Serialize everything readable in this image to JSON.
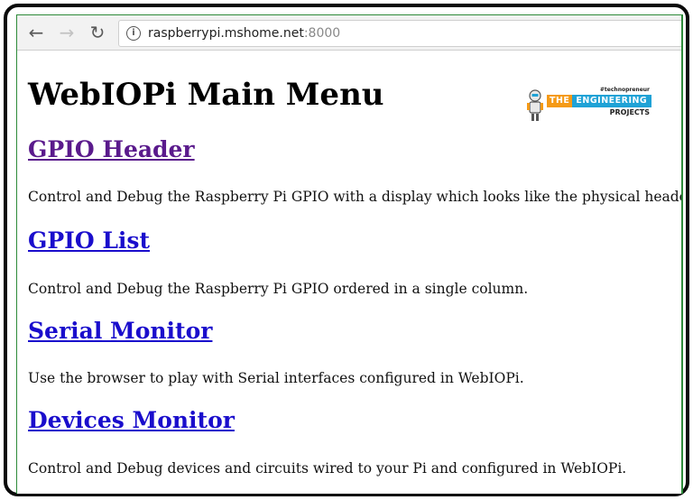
{
  "browser": {
    "nav": {
      "back_icon": "arrow-left",
      "forward_icon": "arrow-right",
      "reload_icon": "reload"
    },
    "address": {
      "host": "raspberrypi.mshome.net",
      "port": ":8000",
      "info_icon": "info-circle"
    }
  },
  "page": {
    "title": "WebIOPi Main Menu",
    "sections": [
      {
        "link": "GPIO Header",
        "description": "Control and Debug the Raspberry Pi GPIO with a display which looks like the physical header."
      },
      {
        "link": "GPIO List",
        "description": "Control and Debug the Raspberry Pi GPIO ordered in a single column."
      },
      {
        "link": "Serial Monitor",
        "description": "Use the browser to play with Serial interfaces configured in WebIOPi."
      },
      {
        "link": "Devices Monitor",
        "description": "Control and Debug devices and circuits wired to your Pi and configured in WebIOPi."
      }
    ]
  },
  "logo": {
    "tagline": "#technopreneur",
    "the": "THE",
    "main": "ENGINEERING",
    "sub": "PROJECTS"
  },
  "colors": {
    "link": "#1a0dcc",
    "visited_link": "#5a1a8c",
    "frame_border": "#2e8b3a",
    "logo_blue": "#1fa2d6",
    "logo_orange": "#f59a16"
  }
}
